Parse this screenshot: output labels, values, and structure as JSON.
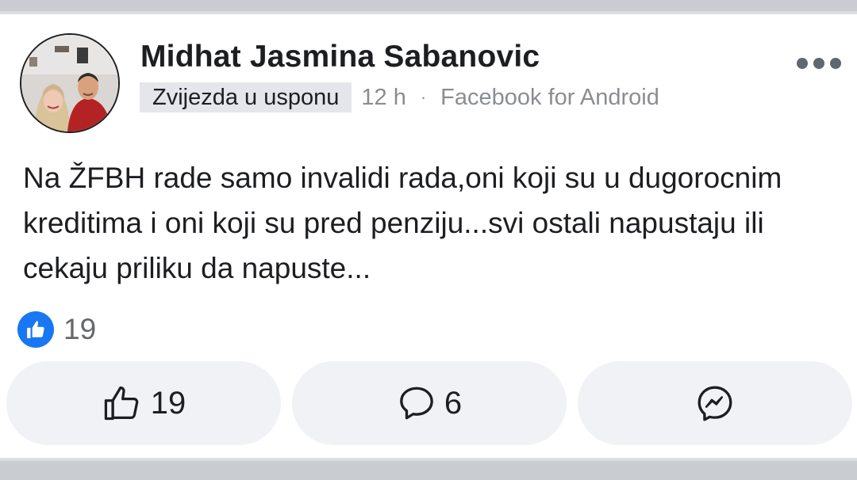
{
  "post": {
    "author": "Midhat Jasmina Sabanovic",
    "badge": "Zvijezda u usponu",
    "time": "12 h",
    "separator": "·",
    "source": "Facebook for Android",
    "text": "Na ŽFBH rade samo invalidi rada,oni koji su u dugorocnim kreditima i oni koji su pred penziju...svi ostali napustaju ili cekaju priliku da napuste...",
    "reactions": {
      "icon": "like-icon",
      "count": "19"
    }
  },
  "actions": {
    "like": {
      "icon": "thumbs-up-icon",
      "count": "19"
    },
    "comment": {
      "icon": "comment-icon",
      "count": "6"
    },
    "share": {
      "icon": "messenger-icon"
    }
  },
  "colors": {
    "accent": "#1877f2",
    "badge_bg": "#e4e6eb",
    "button_bg": "#f0f2f5",
    "meta_text": "#8a8d91",
    "divider": "#c9ccd1"
  }
}
